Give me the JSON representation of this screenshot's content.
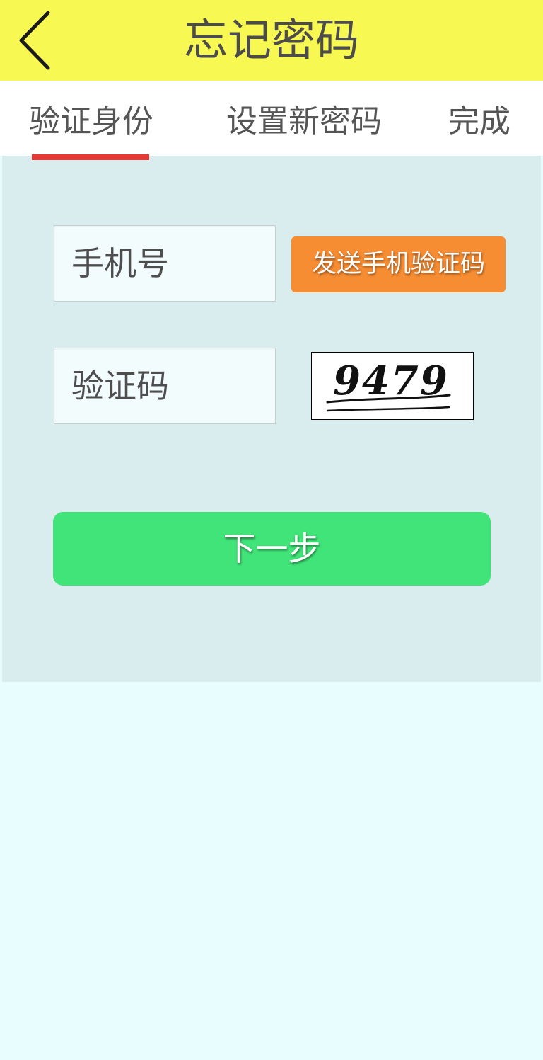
{
  "header": {
    "title": "忘记密码",
    "back_icon": "chevron-left-icon"
  },
  "tabs": [
    {
      "label": "验证身份",
      "active": true
    },
    {
      "label": "设置新密码",
      "active": false
    },
    {
      "label": "完成",
      "active": false
    }
  ],
  "form": {
    "phone_placeholder": "手机号",
    "phone_value": "",
    "send_code_label": "发送手机验证码",
    "code_placeholder": "验证码",
    "code_value": "",
    "captcha_text": "9479"
  },
  "next_label": "下一步",
  "colors": {
    "header_bg": "#f8f852",
    "tab_indicator": "#e53935",
    "send_button": "#f78d33",
    "next_button": "#41e479"
  }
}
